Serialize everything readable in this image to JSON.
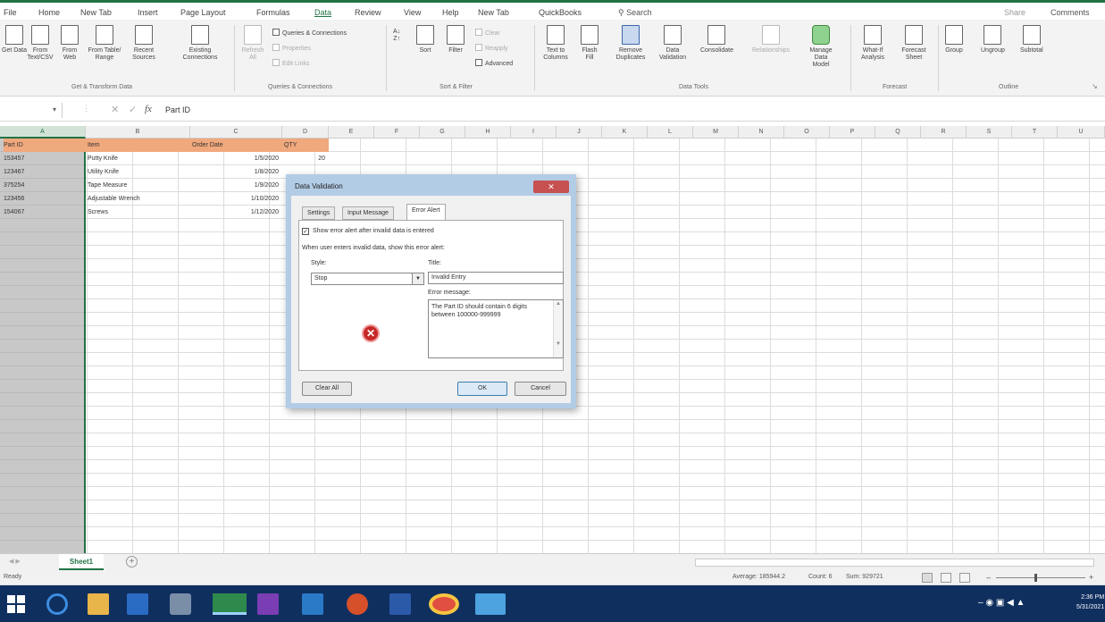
{
  "ribbon_tabs": [
    "File",
    "Home",
    "New Tab",
    "Insert",
    "Page Layout",
    "Formulas",
    "Data",
    "Review",
    "View",
    "Help",
    "New Tab",
    "QuickBooks"
  ],
  "active_tab": "Data",
  "search_label": "Search",
  "share_label": "Share",
  "comments_label": "Comments",
  "ribbon": {
    "get_transform": {
      "buttons": [
        "Get Data",
        "From Text/CSV",
        "From Web",
        "From Table/ Range",
        "Recent Sources",
        "Existing Connections"
      ],
      "label": "Get & Transform Data"
    },
    "queries": {
      "refresh": "Refresh All",
      "items": [
        "Queries & Connections",
        "Properties",
        "Edit Links"
      ],
      "label": "Queries & Connections"
    },
    "sort_filter": {
      "buttons": [
        "Sort",
        "Filter"
      ],
      "items": [
        "Clear",
        "Reapply",
        "Advanced"
      ],
      "label": "Sort & Filter"
    },
    "data_tools": {
      "buttons": [
        "Text to Columns",
        "Flash Fill",
        "Remove Duplicates",
        "Data Validation",
        "Consolidate",
        "Relationships",
        "Manage Data Model"
      ],
      "label": "Data Tools"
    },
    "forecast": {
      "buttons": [
        "What-If Analysis",
        "Forecast Sheet"
      ],
      "label": "Forecast"
    },
    "outline": {
      "buttons": [
        "Group",
        "Ungroup",
        "Subtotal"
      ],
      "label": "Outline"
    }
  },
  "formula_bar": {
    "fx": "fx",
    "value": "Part ID"
  },
  "columns": [
    "A",
    "B",
    "C",
    "D",
    "E",
    "F",
    "G",
    "H",
    "I",
    "J",
    "K",
    "L",
    "M",
    "N",
    "O",
    "P",
    "Q",
    "R",
    "S",
    "T",
    "U"
  ],
  "table": {
    "headers": [
      "Part ID",
      "Item",
      "Order Date",
      "QTY"
    ],
    "rows": [
      [
        "153457",
        "Putty Knife",
        "1/5/2020",
        "20"
      ],
      [
        "123467",
        "Utility Knife",
        "1/8/2020",
        ""
      ],
      [
        "375254",
        "Tape Measure",
        "1/9/2020",
        ""
      ],
      [
        "123456",
        "Adjustable Wrench",
        "1/10/2020",
        ""
      ],
      [
        "154067",
        "Screws",
        "1/12/2020",
        ""
      ]
    ]
  },
  "dialog": {
    "title": "Data Validation",
    "tabs": [
      "Settings",
      "Input Message",
      "Error Alert"
    ],
    "active_tab": "Error Alert",
    "checkbox_label": "Show error alert after invalid data is entered",
    "instruction": "When user enters invalid data, show this error alert:",
    "style_label": "Style:",
    "style_value": "Stop",
    "title_label": "Title:",
    "title_value": "Invalid Entry",
    "message_label": "Error message:",
    "message_value": "The Part ID should contain 6 digits between 100000-999999",
    "clear_all": "Clear All",
    "ok": "OK",
    "cancel": "Cancel"
  },
  "sheet_tab": "Sheet1",
  "status": {
    "ready": "Ready",
    "average": "Average: 185944.2",
    "count": "Count: 6",
    "sum": "Sum: 929721"
  },
  "clock": {
    "time": "2:36 PM",
    "date": "5/31/2021"
  }
}
